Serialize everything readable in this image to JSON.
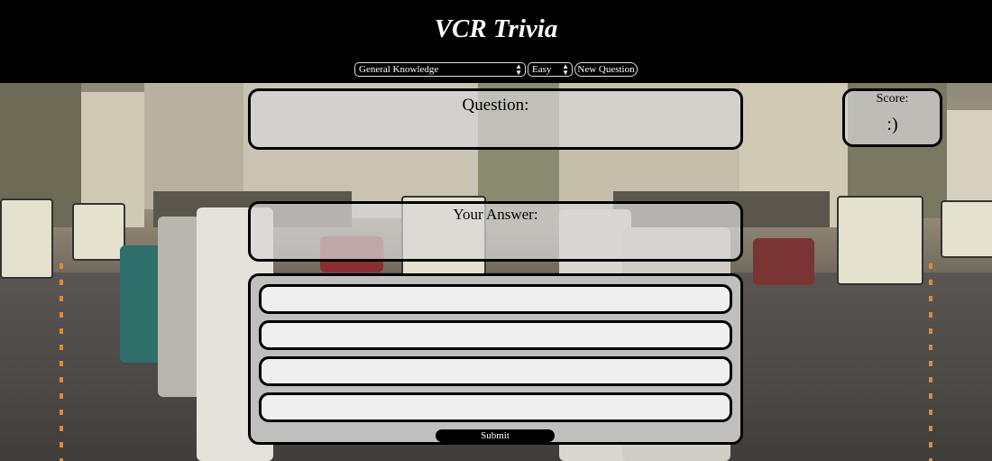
{
  "header": {
    "title": "VCR Trivia",
    "category": {
      "selected": "General Knowledge"
    },
    "difficulty": {
      "selected": "Easy"
    },
    "new_question_label": "New Question"
  },
  "question": {
    "label": "Question:",
    "text": ""
  },
  "answer": {
    "label": "Your Answer:",
    "text": ""
  },
  "score": {
    "label": "Score:",
    "value": ":)"
  },
  "options": [
    "",
    "",
    "",
    ""
  ],
  "submit_label": "Submit",
  "colors": {
    "header_bg": "#000000",
    "panel_border": "#000000",
    "panel_bg": "#d7d7d7",
    "option_bg": "#efefef"
  }
}
